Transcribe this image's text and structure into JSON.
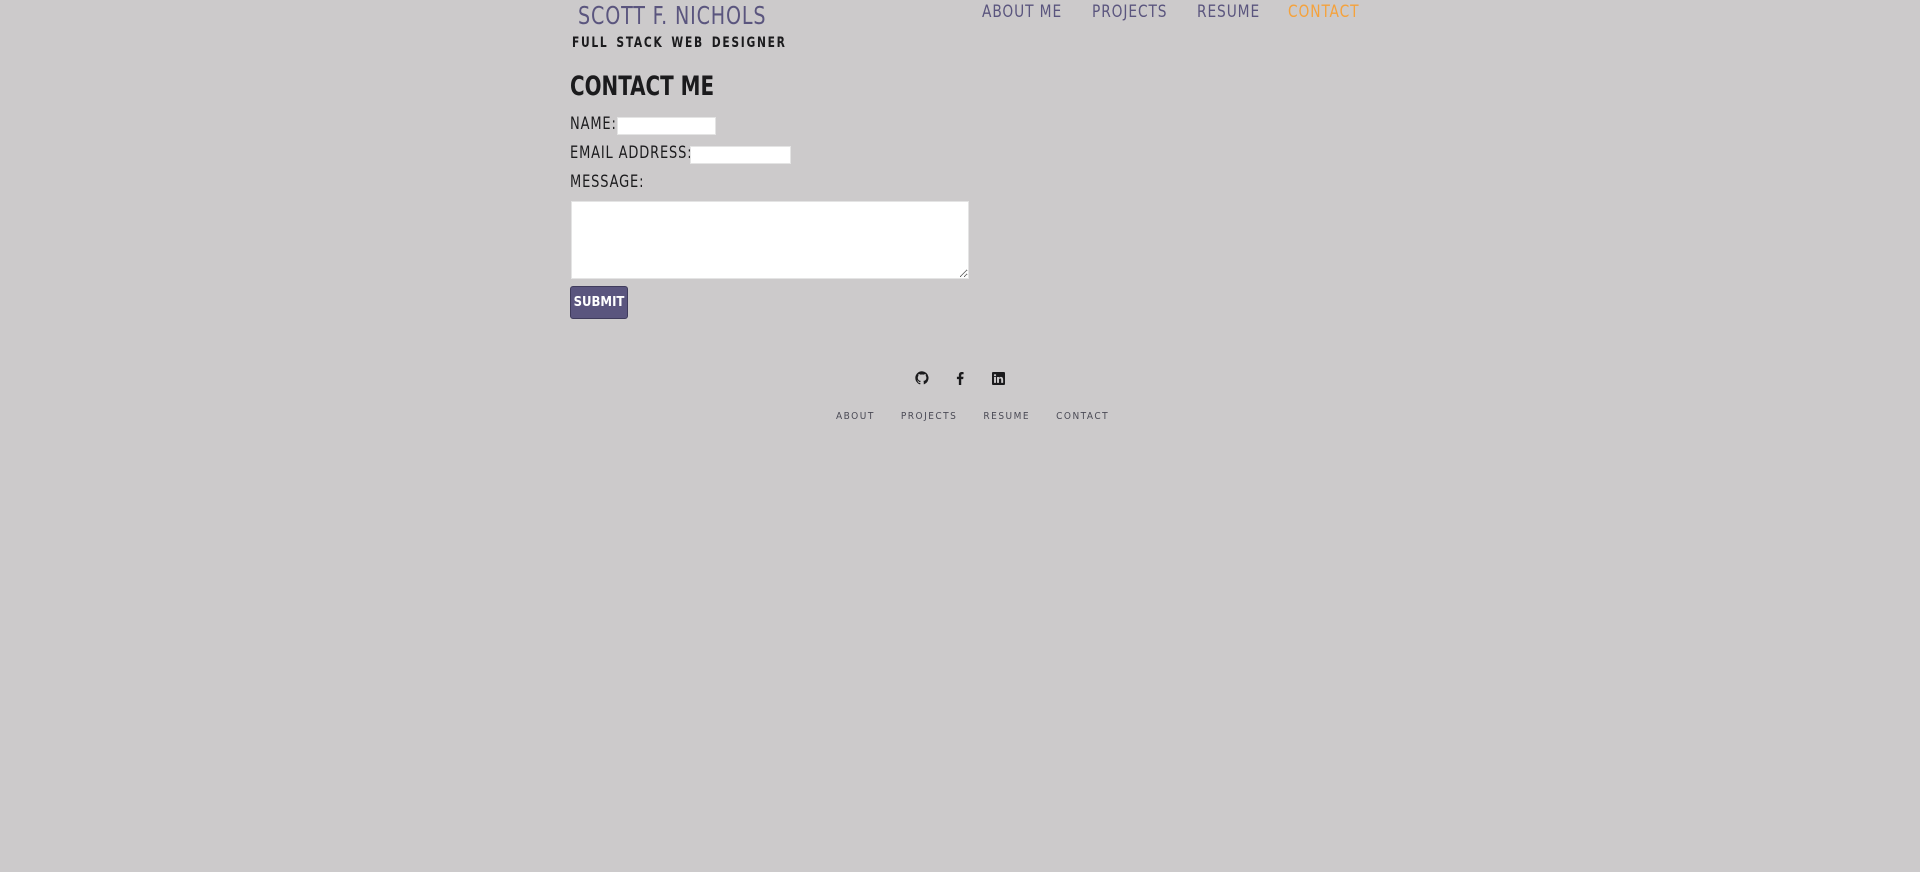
{
  "header": {
    "name": "SCOTT F. NICHOLS",
    "tagline": "FULL STACK WEB DESIGNER"
  },
  "nav": {
    "items": [
      {
        "label": "ABOUT ME"
      },
      {
        "label": "PROJECTS"
      },
      {
        "label": "RESUME"
      },
      {
        "label": "CONTACT",
        "active": true
      }
    ]
  },
  "contact": {
    "title": "CONTACT ME",
    "name_label": "NAME:",
    "name_value": "",
    "email_label": "EMAIL ADDRESS:",
    "email_value": "",
    "message_label": "MESSAGE:",
    "message_value": "",
    "submit_label": "SUBMIT"
  },
  "footer": {
    "social_icons": [
      "github-icon",
      "facebook-icon",
      "linkedin-icon"
    ],
    "links": [
      {
        "label": "ABOUT"
      },
      {
        "label": "PROJECTS"
      },
      {
        "label": "RESUME"
      },
      {
        "label": "CONTACT"
      }
    ]
  },
  "colors": {
    "background": "#cccacb",
    "brand": "#5a557e",
    "accent": "#f5a23c",
    "text": "#1b1b1d"
  }
}
